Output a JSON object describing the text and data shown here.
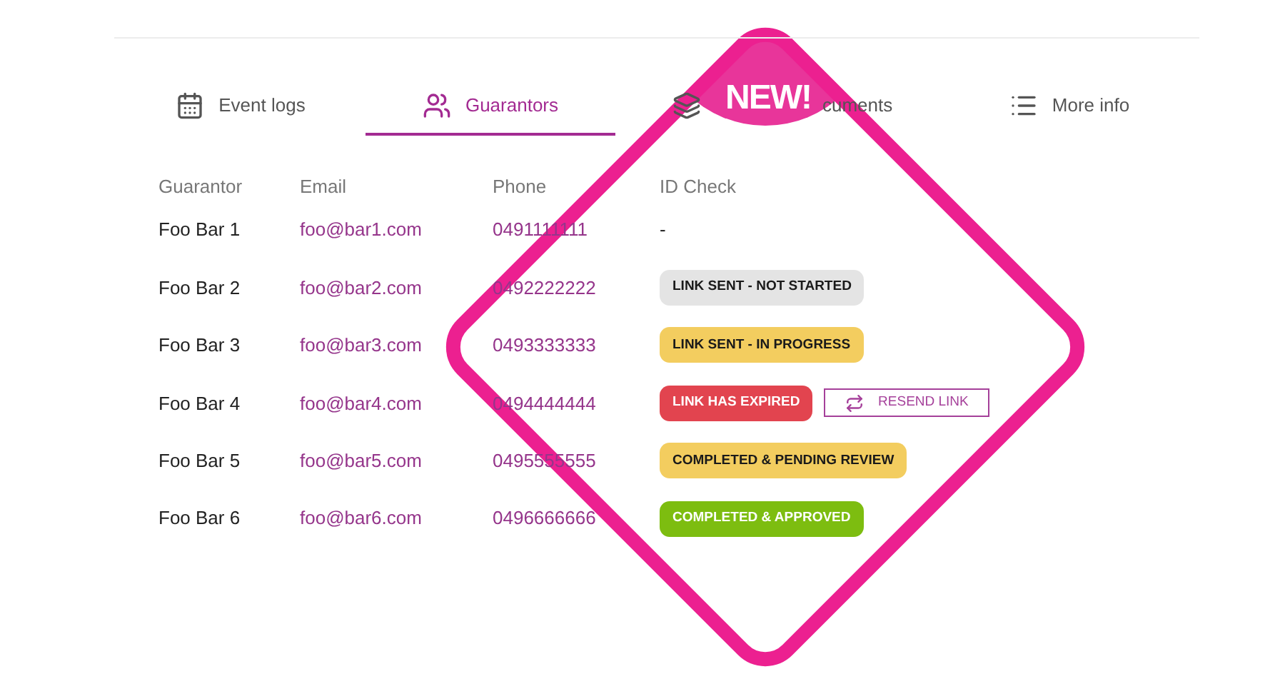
{
  "tabs": [
    {
      "label": "Event logs",
      "selected": false
    },
    {
      "label": "Guarantors",
      "selected": true
    },
    {
      "label": "cuments",
      "selected": false
    },
    {
      "label": "More info",
      "selected": false
    }
  ],
  "table": {
    "columns": [
      "Guarantor",
      "Email",
      "Phone",
      "ID Check"
    ],
    "rows": [
      {
        "name": "Foo Bar 1",
        "email": "foo@bar1.com",
        "phone": "0491111111",
        "id_check": {
          "text": "-",
          "kind": "none"
        }
      },
      {
        "name": "Foo Bar 2",
        "email": "foo@bar2.com",
        "phone": "0492222222",
        "id_check": {
          "text": "LINK SENT - NOT STARTED",
          "kind": "not_started"
        }
      },
      {
        "name": "Foo Bar 3",
        "email": "foo@bar3.com",
        "phone": "0493333333",
        "id_check": {
          "text": "LINK SENT - IN PROGRESS",
          "kind": "in_progress"
        }
      },
      {
        "name": "Foo Bar 4",
        "email": "foo@bar4.com",
        "phone": "0494444444",
        "id_check": {
          "text": "LINK HAS EXPIRED",
          "kind": "expired"
        },
        "action": "RESEND LINK"
      },
      {
        "name": "Foo Bar 5",
        "email": "foo@bar5.com",
        "phone": "0495555555",
        "id_check": {
          "text": "COMPLETED & PENDING REVIEW",
          "kind": "pending"
        }
      },
      {
        "name": "Foo Bar 6",
        "email": "foo@bar6.com",
        "phone": "0496666666",
        "id_check": {
          "text": "COMPLETED & APPROVED",
          "kind": "approved"
        }
      }
    ]
  },
  "badge": {
    "text": "NEW!"
  }
}
